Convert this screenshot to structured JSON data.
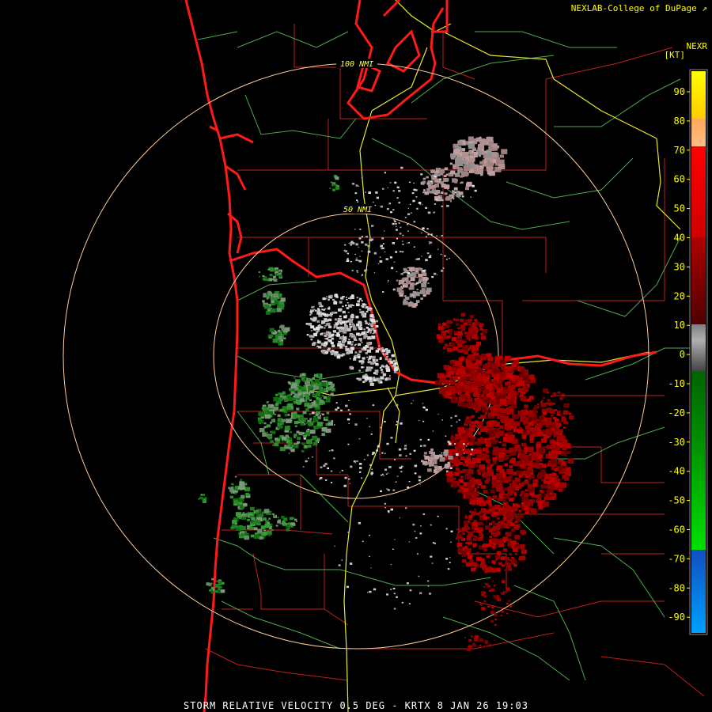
{
  "header": {
    "credit": "NEXLAB-College of DuPage",
    "credit_link_icon": "external-link-icon",
    "product_abbrev": "NEXR",
    "units": "[KT]"
  },
  "rings": [
    {
      "label": "50 NMI"
    },
    {
      "label": "100 NMI"
    }
  ],
  "color_scale": {
    "ticks": [
      "90",
      "80",
      "70",
      "60",
      "50",
      "40",
      "30",
      "20",
      "10",
      "0",
      "-10",
      "-20",
      "-30",
      "-40",
      "-50",
      "-60",
      "-70",
      "-80",
      "-90"
    ],
    "colors": {
      "outbound_high": "#ff0000",
      "outbound_mid": "#a00000",
      "outbound_low": "#500000",
      "near_zero": "#b0b0b0",
      "inbound_low": "#006400",
      "inbound_mid": "#00c000",
      "inbound_high": "#00e000",
      "folded": "#00a0ff",
      "top": "#ffff00"
    }
  },
  "footer": {
    "title": "STORM RELATIVE VELOCITY 0.5 DEG - KRTX 8 JAN 26 19:03"
  }
}
